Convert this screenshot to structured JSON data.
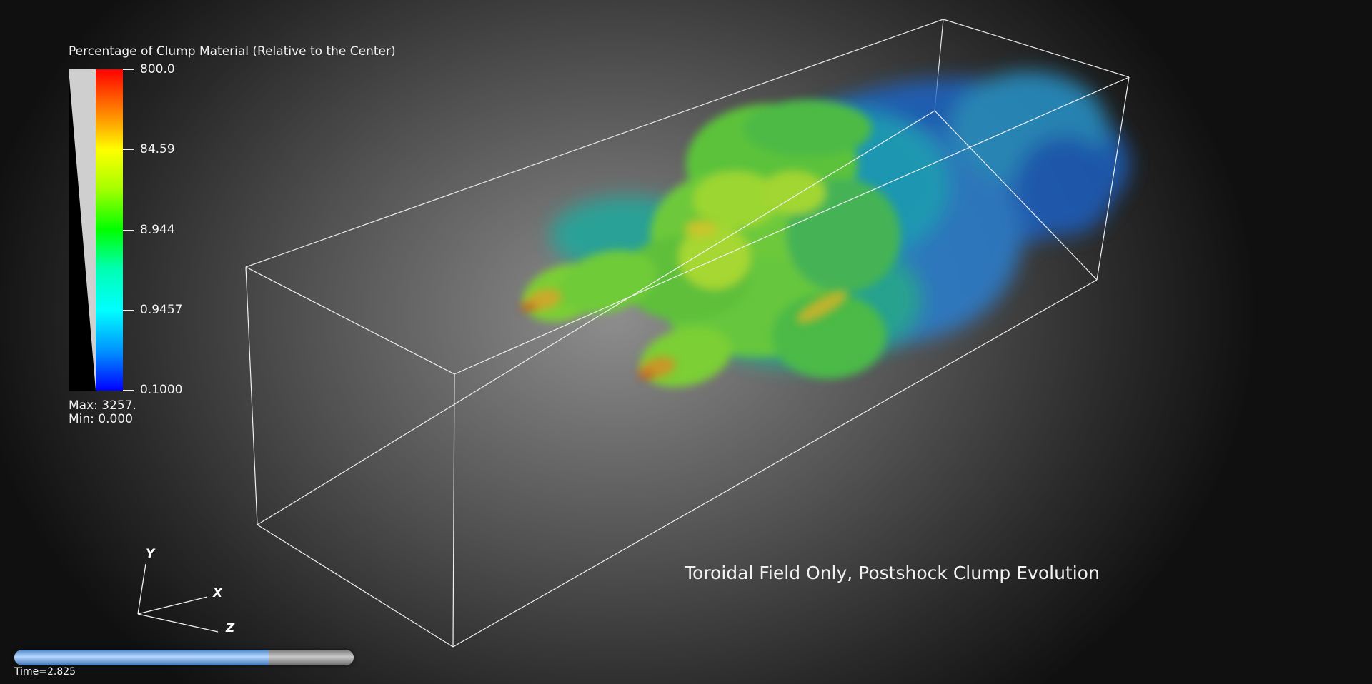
{
  "colorbar": {
    "title": "Percentage of Clump Material (Relative to the Center)",
    "tick_labels": [
      "800.0",
      "84.59",
      "8.944",
      "0.9457",
      "0.1000"
    ],
    "max_label": "Max:  3257.",
    "min_label": "Min:  0.000"
  },
  "caption": "Toroidal Field Only, Postshock Clump Evolution",
  "axes": {
    "y": "Y",
    "x": "X",
    "z": "Z"
  },
  "time": {
    "label": "Time=2.825",
    "progress": 0.75
  },
  "colors": {
    "box": "#f0f0f0",
    "slider_fill": "#8ab8ee",
    "colormap_high": "#ff0000",
    "colormap_low": "#0000ff"
  }
}
